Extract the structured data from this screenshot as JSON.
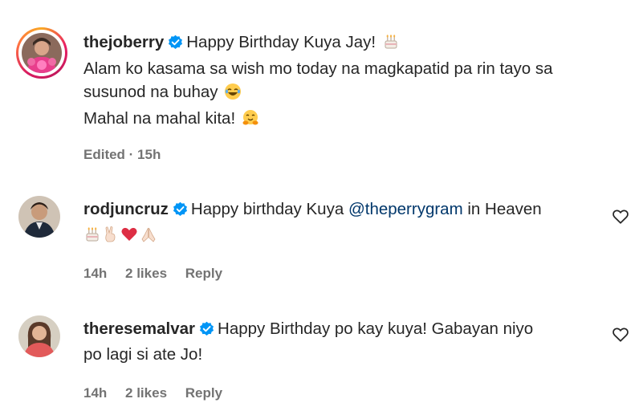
{
  "comments": [
    {
      "username": "thejoberry",
      "verified": true,
      "line1": "Happy Birthday Kuya Jay!",
      "line2": "Alam ko kasama sa wish mo today na magkapatid pa rin tayo sa",
      "line3": "susunod na buhay",
      "line4": "Mahal na mahal kita!",
      "meta": "Edited · 15h",
      "emoji_line1": "birthday-cake-icon",
      "emoji_line3": "laughing-face-icon",
      "emoji_line4": "hugging-face-icon"
    },
    {
      "username": "rodjuncruz",
      "verified": true,
      "text_before": "Happy birthday Kuya",
      "mention": "@theperrygram",
      "text_after": "in Heaven",
      "emojis": [
        "birthday-cake-icon",
        "victory-hand-icon",
        "red-heart-icon",
        "praying-hands-icon"
      ],
      "time": "14h",
      "likes": "2 likes",
      "reply": "Reply"
    },
    {
      "username": "theresemalvar",
      "verified": true,
      "line1": "Happy Birthday po kay kuya! Gabayan niyo",
      "line2": "po lagi si ate Jo!",
      "time": "14h",
      "likes": "2 likes",
      "reply": "Reply"
    }
  ],
  "colors": {
    "text": "#262626",
    "meta": "#737373",
    "mention": "#00376b",
    "verified": "#0095f6"
  }
}
